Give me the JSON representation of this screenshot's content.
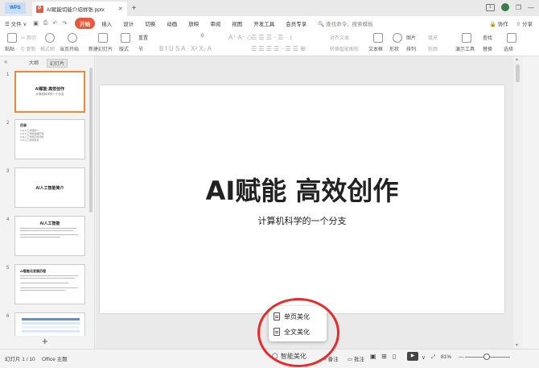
{
  "titlebar": {
    "app_tab": "WPS",
    "doc_name": "AI赋能切能介绍样张.pptx",
    "new_tab": "+",
    "window_controls": [
      "❐",
      "—"
    ]
  },
  "menubar": {
    "file": "☰ 文件 ∨",
    "items": [
      "开始",
      "插入",
      "设计",
      "切换",
      "动画",
      "放映",
      "审阅",
      "视图",
      "开发工具",
      "会员专享"
    ],
    "search": "🔍 查找命令、搜索模板",
    "right": [
      "🔒 协作",
      "⇧ 分享"
    ]
  },
  "ribbon": {
    "paste": "粘贴",
    "cut": "✂ 剪切",
    "copy": "⎘ 复制",
    "format_painter": "格式刷",
    "play_from_current": "当页开始",
    "new_slide": "新建幻灯片",
    "layout": "版式",
    "section": "节",
    "reset": "重置",
    "font_size": "0",
    "text_box": "文本框",
    "shape": "形状",
    "arrange": "排列",
    "picture": "图片",
    "fill": "填充",
    "outline": "轮廓",
    "presentation_tools": "演示工具",
    "find": "查找",
    "replace": "替换",
    "select": "选择",
    "convert_art": "转换智能图形",
    "align_text": "对齐文本"
  },
  "left_panel": {
    "tabs": [
      "大纲",
      "幻灯片"
    ],
    "collapse": "«",
    "add": "+",
    "slides": [
      {
        "num": "1",
        "title": "AI赋能 高效创作",
        "sub": "计算机科学的一个分支"
      },
      {
        "num": "2",
        "title": "目录",
        "items": [
          "1.AI人工智能简介",
          "2.AI人工智能发展历程",
          "3.AI人工智能应用领域",
          "4.AI人工智能未来"
        ]
      },
      {
        "num": "3",
        "title": "AI人工智能简介"
      },
      {
        "num": "4",
        "title": "AI人工智能"
      },
      {
        "num": "5",
        "title": "AI智能化发展历程"
      },
      {
        "num": "6",
        "title": ""
      }
    ]
  },
  "slide": {
    "title": "AI赋能 高效创作",
    "subtitle": "计算机科学的一个分支"
  },
  "beautify_popup": {
    "single_page": "单页美化",
    "full_text": "全文美化"
  },
  "statusbar": {
    "slide_counter": "幻灯片 1 / 10",
    "theme": "Office 主题",
    "smart_beautify": "智能美化",
    "notes": "备注",
    "comments": "批注",
    "zoom": "81%",
    "play": "▶"
  },
  "colors": {
    "accent": "#e8593c",
    "selection": "#e8893c",
    "annotation": "#e82c2c"
  }
}
